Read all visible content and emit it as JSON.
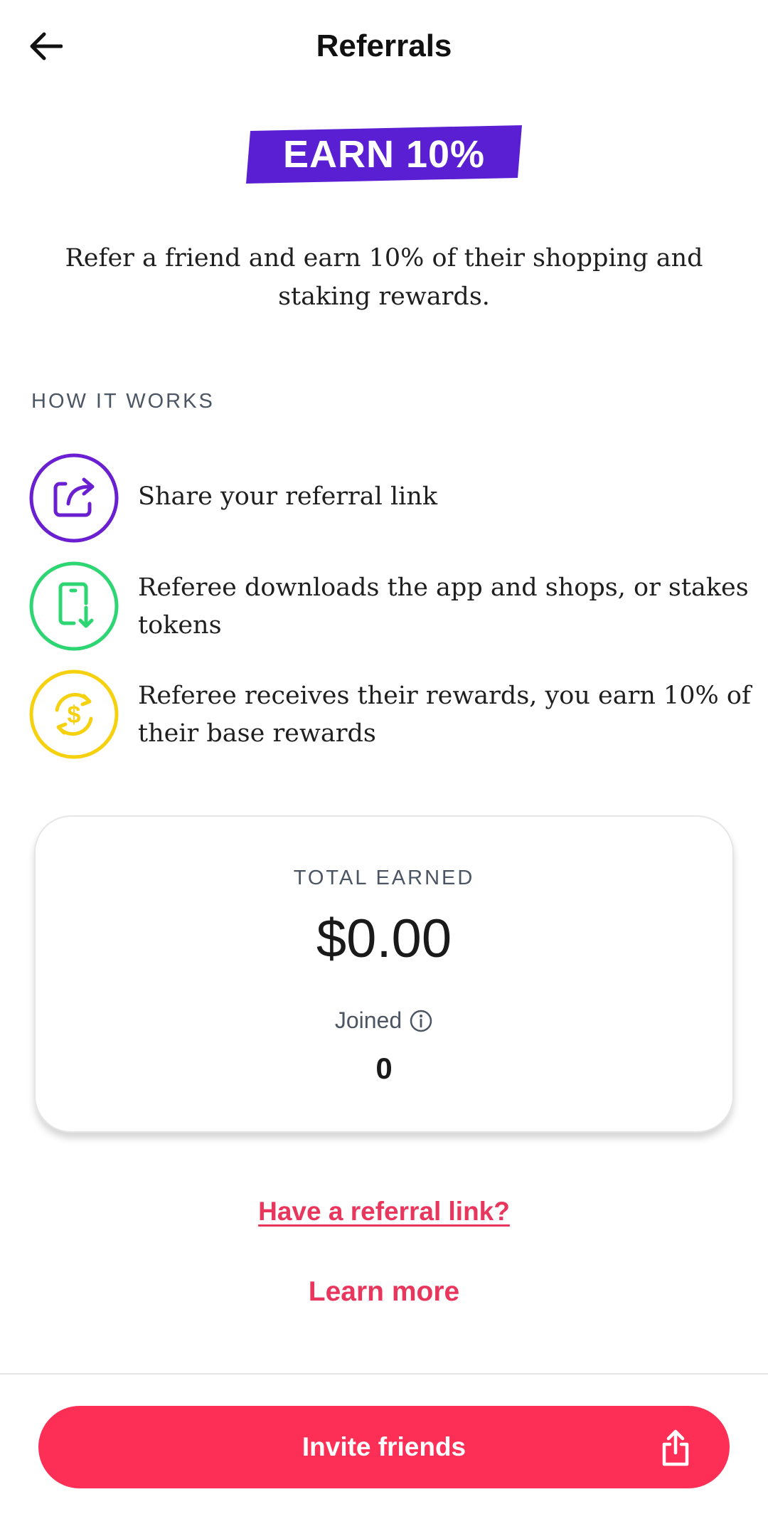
{
  "header": {
    "title": "Referrals",
    "back_icon": "arrow-left-icon"
  },
  "banner": {
    "text": "EARN 10%",
    "color": "#5b1fd3"
  },
  "intro": "Refer a friend and earn 10% of their shopping and staking rewards.",
  "how_it_works": {
    "label": "HOW IT WORKS",
    "steps": [
      {
        "icon": "share-icon",
        "color": "#6a1fd1",
        "text": "Share your referral link"
      },
      {
        "icon": "phone-download-icon",
        "color": "#2ed573",
        "text": "Referee downloads the app and shops, or stakes tokens"
      },
      {
        "icon": "dollar-cycle-icon",
        "color": "#f5d10f",
        "text": "Referee receives their rewards, you earn 10% of their base rewards"
      }
    ]
  },
  "earnings": {
    "label": "TOTAL EARNED",
    "amount": "$0.00",
    "joined_label": "Joined",
    "joined_count": "0"
  },
  "links": {
    "referral": "Have a referral link?",
    "learn_more": "Learn more"
  },
  "invite": {
    "label": "Invite friends",
    "icon": "share-upload-icon",
    "color": "#fd2f57"
  },
  "accent_color": "#e8365d"
}
